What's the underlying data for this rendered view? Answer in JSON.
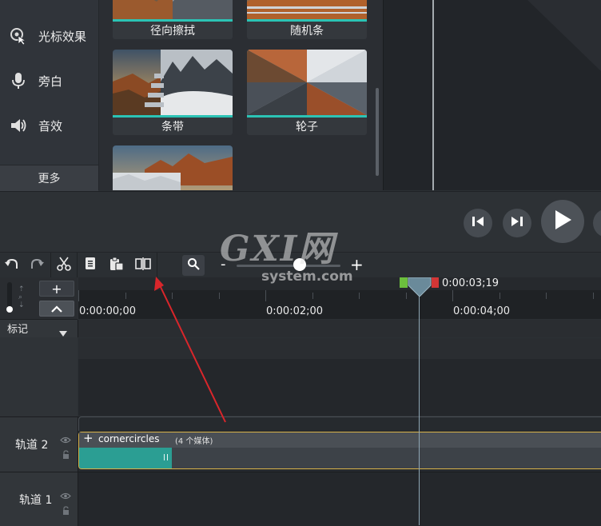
{
  "sidebar": {
    "items": [
      {
        "label": "光标效果",
        "icon": "cursor-effect-icon"
      },
      {
        "label": "旁白",
        "icon": "microphone-icon"
      },
      {
        "label": "音效",
        "icon": "speaker-icon"
      }
    ],
    "more_label": "更多"
  },
  "library": {
    "tiles": [
      {
        "label": "径向擦拭"
      },
      {
        "label": "随机条"
      },
      {
        "label": "条带"
      },
      {
        "label": "轮子"
      },
      {
        "label": ""
      }
    ]
  },
  "toolbar": {
    "zoom_minus": "-",
    "zoom_plus": "+",
    "zoom_level": 0.61
  },
  "timeline": {
    "zoom_add": "+",
    "ticks": [
      "0:00:00;00",
      "0:00:02;00",
      "0:00:04;00"
    ],
    "playhead_time": "0:00:03;19",
    "markers_label": "标记",
    "tracks": [
      {
        "name": "轨道 2"
      },
      {
        "name": "轨道 1"
      }
    ],
    "clip": {
      "plus": "+",
      "title": "cornercircles",
      "count": "(4 个媒体)"
    }
  },
  "watermark": {
    "main": "GXI网",
    "sub": "system.com"
  },
  "colors": {
    "accent": "#2bc3b5",
    "clip_border": "#d8b24a",
    "in_marker": "#6cbf3d",
    "out_marker": "#d23636",
    "annotation_arrow": "#d9262b"
  }
}
